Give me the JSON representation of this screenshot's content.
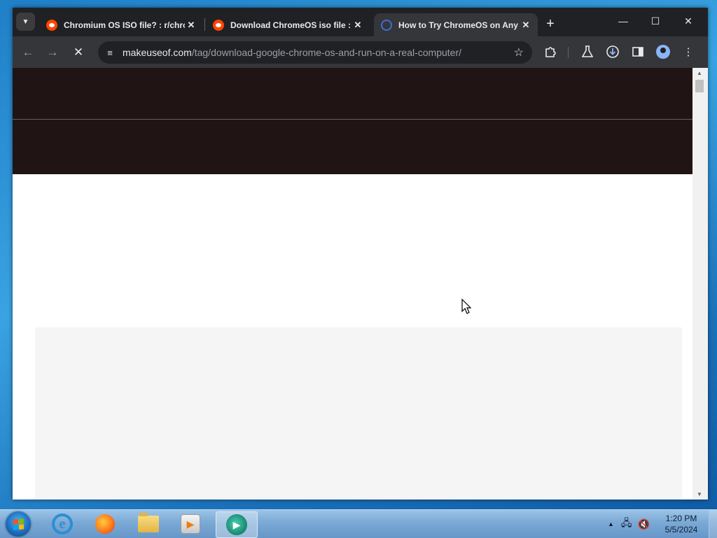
{
  "browser": {
    "tabs": [
      {
        "title": "Chromium OS ISO file? : r/chro",
        "favicon": "reddit-icon",
        "active": false
      },
      {
        "title": "Download ChromeOS iso file :",
        "favicon": "reddit-icon",
        "active": false
      },
      {
        "title": "How to Try ChromeOS on Any",
        "favicon": "makeuseof-icon",
        "active": true
      }
    ],
    "new_tab_symbol": "+",
    "window_controls": {
      "minimize": "—",
      "maximize": "☐",
      "close": "✕"
    },
    "toolbar": {
      "back_icon": "←",
      "forward_icon": "→",
      "stop_icon": "✕"
    },
    "omnibox": {
      "host": "makeuseof.com",
      "path": "/tag/download-google-chrome-os-and-run-on-a-real-computer/",
      "bookmark_icon": "☆"
    },
    "colors": {
      "tabstrip": "#202124",
      "toolbar": "#35363a",
      "page_header": "#201414"
    }
  },
  "taskbar": {
    "clock": {
      "time": "1:20 PM",
      "date": "5/5/2024"
    },
    "apps": [
      "internet-explorer",
      "firefox",
      "file-explorer",
      "media-player",
      "active-app"
    ]
  }
}
